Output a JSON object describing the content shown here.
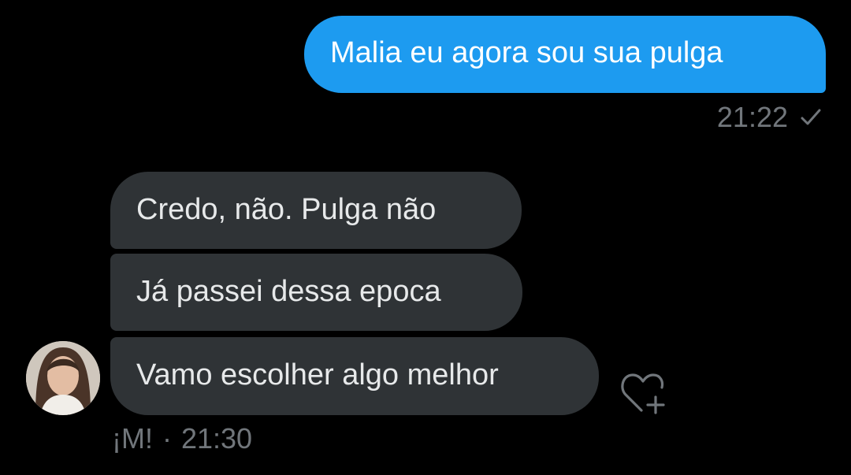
{
  "messages": {
    "sent": {
      "text": "Malia eu agora sou sua pulga",
      "time": "21:22",
      "status_icon": "check-icon"
    },
    "received": [
      {
        "text": "Credo, não. Pulga não"
      },
      {
        "text": "Já passei dessa epoca"
      },
      {
        "text": "Vamo escolher algo melhor"
      }
    ],
    "received_meta": {
      "sender": "¡M!",
      "separator": "·",
      "time": "21:30"
    },
    "reaction_icon": "add-reaction-heart-icon",
    "avatar_icon": "avatar"
  },
  "colors": {
    "background": "#000000",
    "sent_bubble": "#1d9bf0",
    "received_bubble": "#2f3336",
    "meta_text": "#71767b"
  }
}
